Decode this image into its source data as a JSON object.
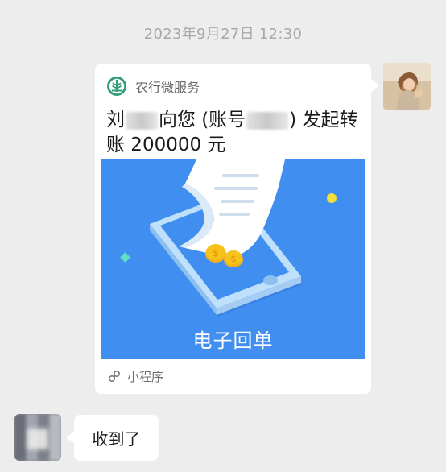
{
  "chat": {
    "timestamp": "2023年9月27日 12:30"
  },
  "card": {
    "brand": "农行微服务",
    "title_prefix": "刘",
    "title_mid1": "向您 (账号",
    "title_mid2": ") 发起转",
    "title_line2": "账 200000 元",
    "banner_label": "电子回单",
    "footer_label": "小程序",
    "colors": {
      "banner_bg": "#3f8ef0",
      "brand_green": "#2f9e79",
      "coin": "#f6c21b"
    }
  },
  "reply": {
    "text": "收到了"
  },
  "icons": {
    "brand": "abc-bank-logo-icon",
    "mini_program": "mini-program-icon"
  }
}
